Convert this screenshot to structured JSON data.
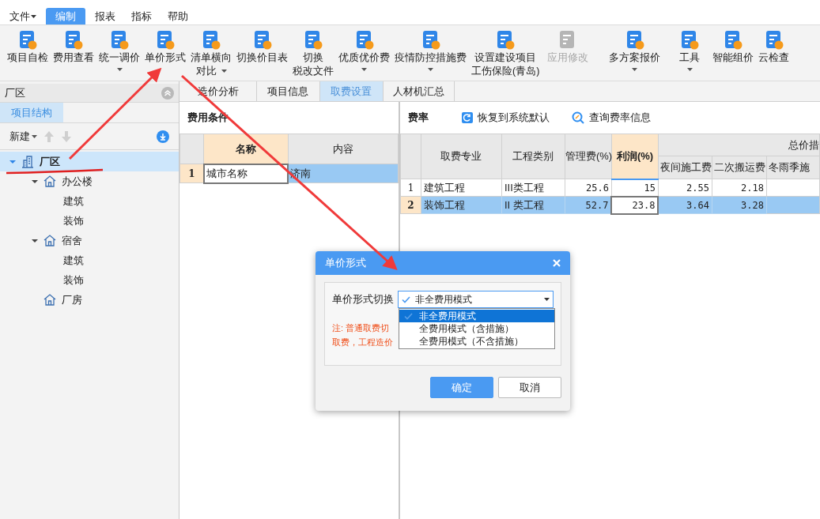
{
  "menu": [
    {
      "label": "文件",
      "caret": true,
      "selected": false
    },
    {
      "label": "编制",
      "caret": false,
      "selected": true
    },
    {
      "label": "报表",
      "caret": false,
      "selected": false
    },
    {
      "label": "指标",
      "caret": false,
      "selected": false
    },
    {
      "label": "帮助",
      "caret": false,
      "selected": false
    }
  ],
  "toolbar": [
    {
      "lines": [
        "项目自检"
      ],
      "caret": false,
      "disabled": false
    },
    {
      "lines": [
        "费用查看"
      ],
      "caret": false,
      "disabled": false
    },
    {
      "lines": [
        "统一调价"
      ],
      "caret": true,
      "disabled": false
    },
    {
      "lines": [
        "单价形式"
      ],
      "caret": false,
      "disabled": false
    },
    {
      "lines": [
        "清单横向",
        "对比"
      ],
      "caret": true,
      "disabled": false
    },
    {
      "lines": [
        "切换价目表"
      ],
      "caret": false,
      "disabled": false
    },
    {
      "lines": [
        "切换",
        "税改文件"
      ],
      "caret": false,
      "disabled": false
    },
    {
      "lines": [
        "优质优价费"
      ],
      "caret": true,
      "disabled": false
    },
    {
      "lines": [
        "疫情防控措施费"
      ],
      "caret": true,
      "disabled": false
    },
    {
      "lines": [
        "设置建设项目",
        "工伤保险(青岛)"
      ],
      "caret": false,
      "disabled": false
    },
    {
      "lines": [
        "应用修改"
      ],
      "caret": false,
      "disabled": true
    },
    {
      "lines": [
        "多方案报价"
      ],
      "caret": true,
      "disabled": false
    },
    {
      "lines": [
        "工具"
      ],
      "caret": true,
      "disabled": false
    },
    {
      "lines": [
        "智能组价"
      ],
      "caret": false,
      "disabled": false
    },
    {
      "lines": [
        "云检查"
      ],
      "caret": false,
      "disabled": false
    }
  ],
  "left_panel": {
    "title": "厂区",
    "tabs": [
      {
        "label": "项目结构",
        "selected": true
      }
    ],
    "new_button": "新建",
    "tree": [
      {
        "label": "厂区",
        "kind": "building",
        "expanded": true,
        "selected": true,
        "children": [
          {
            "label": "办公楼",
            "kind": "house",
            "expanded": true,
            "selected": false,
            "children": [
              {
                "label": "建筑",
                "selected": false
              },
              {
                "label": "装饰",
                "selected": false
              }
            ]
          },
          {
            "label": "宿舍",
            "kind": "house",
            "expanded": true,
            "selected": false,
            "children": [
              {
                "label": "建筑",
                "selected": false
              },
              {
                "label": "装饰",
                "selected": false
              }
            ]
          },
          {
            "label": "厂房",
            "kind": "house",
            "selected": false
          }
        ]
      }
    ]
  },
  "tabs": [
    {
      "label": "造价分析",
      "selected": false
    },
    {
      "label": "项目信息",
      "selected": false
    },
    {
      "label": "取费设置",
      "selected": true
    },
    {
      "label": "人材机汇总",
      "selected": false
    }
  ],
  "fee_conditions": {
    "title": "费用条件",
    "columns": [
      {
        "label": "名称",
        "selected": true
      },
      {
        "label": "内容",
        "selected": false
      }
    ],
    "rows": [
      {
        "index": "1",
        "cells": [
          "城市名称",
          "济南"
        ],
        "selected": true
      }
    ]
  },
  "rates": {
    "title": "费率",
    "actions": [
      {
        "label": "恢复到系统默认",
        "kind": "restore"
      },
      {
        "label": "查询费率信息",
        "kind": "query"
      }
    ],
    "columns": [
      {
        "label": "取费专业",
        "selected": false
      },
      {
        "label": "工程类别",
        "selected": false
      },
      {
        "label": "管理费(%)",
        "selected": false
      },
      {
        "label": "利润(%)",
        "selected": true
      }
    ],
    "group": {
      "label": "总价措",
      "columns": [
        "夜间施工费",
        "二次搬运费",
        "冬雨季施"
      ]
    },
    "rows": [
      {
        "index": "1",
        "cells": [
          "建筑工程",
          "III类工程",
          "25.6",
          "15",
          "2.55",
          "2.18"
        ],
        "selected": false
      },
      {
        "index": "2",
        "cells": [
          "装饰工程",
          "II 类工程",
          "52.7",
          "23.8",
          "3.64",
          "3.28"
        ],
        "selected": true
      }
    ]
  },
  "dialog": {
    "title": "单价形式",
    "field_label": "单价形式切换",
    "value": "非全费用模式",
    "options": [
      {
        "label": "非全费用模式",
        "selected": true
      },
      {
        "label": "全费用模式（含措施）",
        "selected": false
      },
      {
        "label": "全费用模式（不含措施）",
        "selected": false
      }
    ],
    "note": [
      "注: 普通取费切",
      "取费，工程造价"
    ],
    "buttons": [
      {
        "label": "确定",
        "kind": "primary"
      },
      {
        "label": "取消",
        "kind": "secondary"
      }
    ]
  }
}
